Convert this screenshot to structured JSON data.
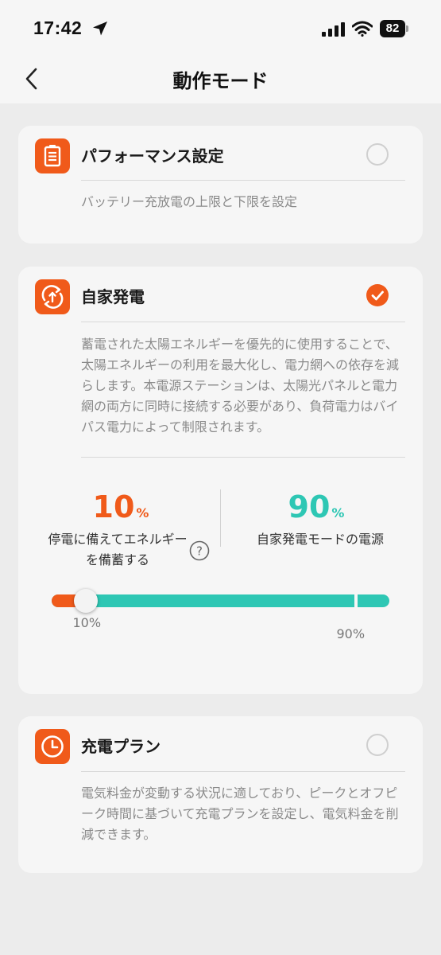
{
  "status_bar": {
    "time": "17:42",
    "battery": "82"
  },
  "nav": {
    "title": "動作モード"
  },
  "cards": [
    {
      "title": "パフォーマンス設定",
      "description": "バッテリー充放電の上限と下限を設定",
      "selected": false,
      "icon": "battery-settings-icon"
    },
    {
      "title": "自家発電",
      "description": "蓄電された太陽エネルギーを優先的に使用することで、太陽エネルギーの利用を最大化し、電力網への依存を減らします。本電源ステーションは、太陽光パネルと電力網の両方に同時に接続する必要があり、負荷電力はバイパス電力によって制限されます。",
      "selected": true,
      "icon": "self-generation-icon"
    },
    {
      "title": "充電プラン",
      "description": "電気料金が変動する状況に適しており、ピークとオフピーク時間に基づいて充電プランを設定し、電気料金を削減できます。",
      "selected": false,
      "icon": "clock-icon"
    }
  ],
  "self_generation": {
    "reserve": {
      "value": "10",
      "unit": "%",
      "label": "停電に備えてエネルギーを備蓄する",
      "color": "#f05a1a"
    },
    "power_source": {
      "value": "90",
      "unit": "%",
      "label": "自家発電モードの電源",
      "color": "#2ec7b4"
    },
    "slider": {
      "low": 10,
      "high": 90,
      "low_label": "10%",
      "high_label": "90%"
    }
  }
}
